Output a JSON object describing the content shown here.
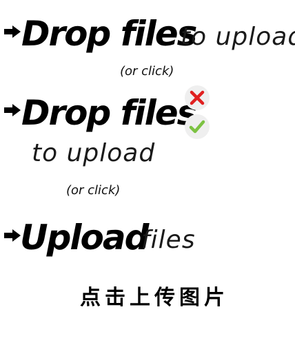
{
  "variant1": {
    "title": "Drop files",
    "subtitle": "to upload",
    "hint": "(or click)",
    "icon": "arrow-right-icon"
  },
  "variant2": {
    "title": "Drop files",
    "subtitle": "to upload",
    "hint": "(or click)",
    "icon": "arrow-right-icon",
    "error_icon": "close-icon",
    "success_icon": "check-icon",
    "colors": {
      "error": "#e02020",
      "success": "#7cc242",
      "circle_bg": "#efefef"
    }
  },
  "variant3": {
    "title": "Upload",
    "subtitle": "files",
    "icon": "arrow-right-icon"
  },
  "variant4": {
    "label": "点击上传图片"
  }
}
